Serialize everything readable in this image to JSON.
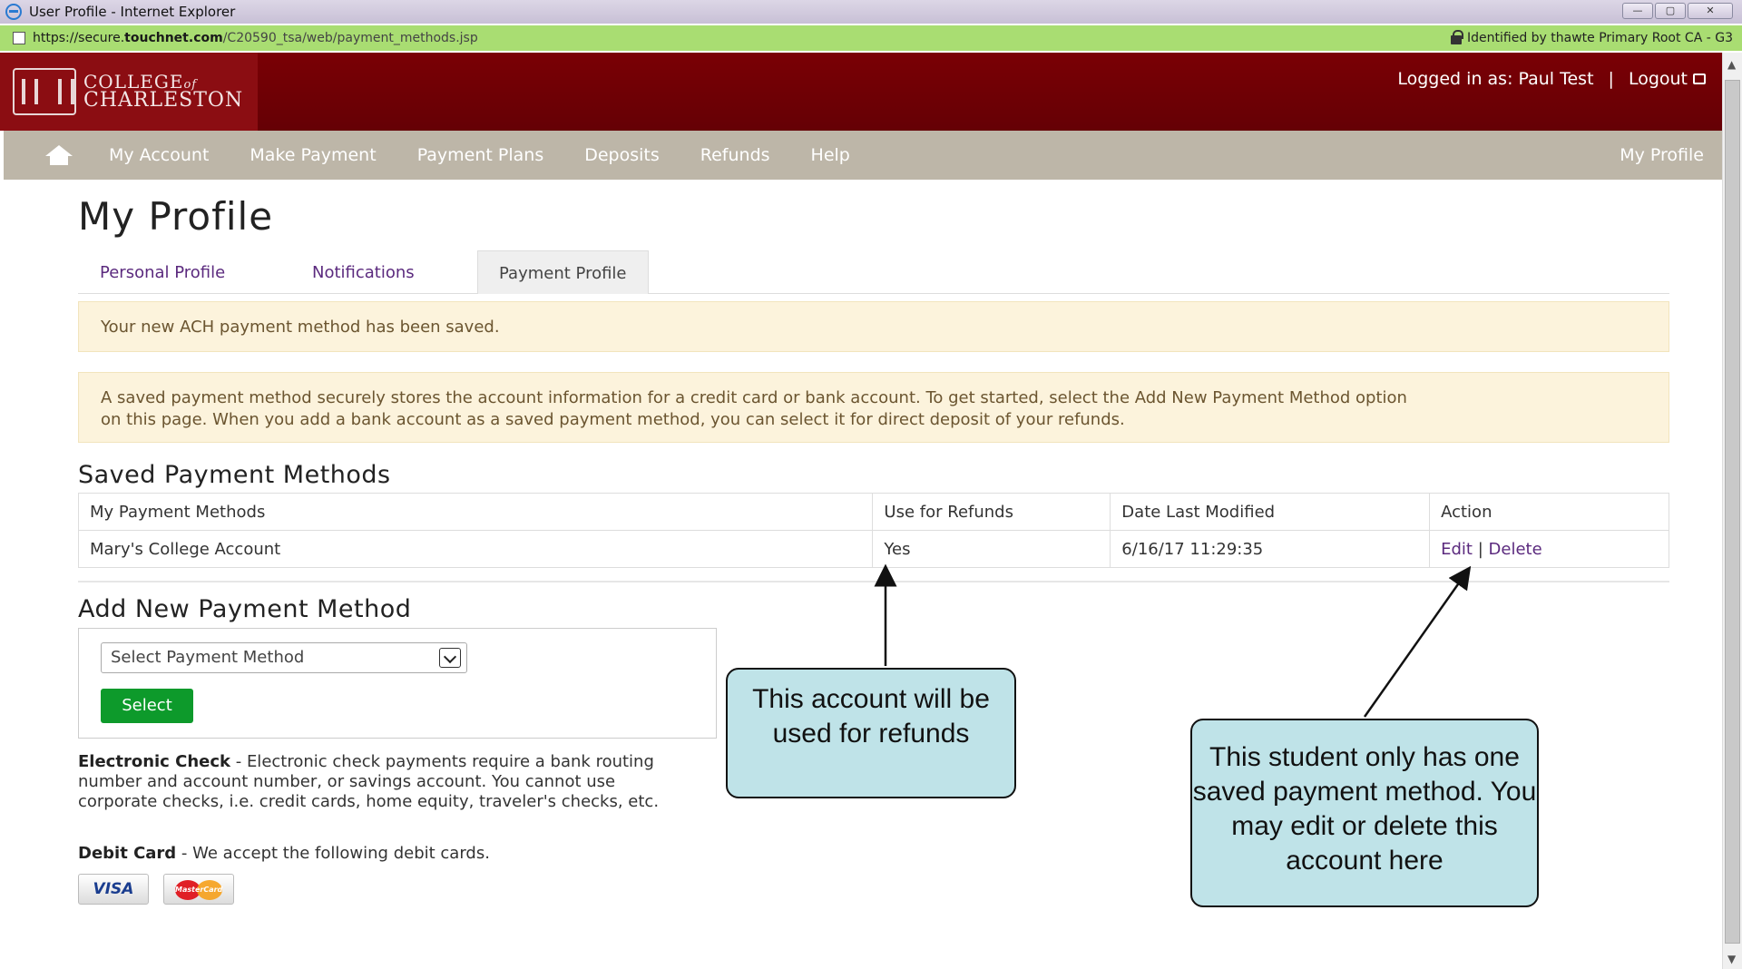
{
  "window": {
    "title": "User Profile - Internet Explorer",
    "controls": [
      "—",
      "▢",
      "✕"
    ]
  },
  "address_bar": {
    "url_scheme": "https://secure.",
    "url_domain": "touchnet.com",
    "url_path": "/C20590_tsa/web/payment_methods.jsp",
    "security_text": "Identified by thawte Primary Root CA - G3"
  },
  "header": {
    "logo_line1": "COLLEGE",
    "logo_line1_of": "of",
    "logo_line2": "CHARLESTON",
    "logged_in_text": "Logged in as: Paul Test",
    "separator": "|",
    "logout_label": "Logout"
  },
  "nav": {
    "items": [
      "My Account",
      "Make Payment",
      "Payment Plans",
      "Deposits",
      "Refunds",
      "Help"
    ],
    "right_item": "My Profile"
  },
  "page": {
    "title": "My Profile",
    "tabs": [
      "Personal Profile",
      "Notifications",
      "Payment Profile"
    ],
    "active_tab": "Payment Profile",
    "success_message": "Your new ACH payment method has been saved.",
    "info_message_line1": "A saved payment method securely stores the account information for a credit card or bank account. To get started, select the Add New Payment Method option",
    "info_message_line2": "on this page. When you add a bank account as a saved payment method, you can select it for direct deposit of your refunds."
  },
  "saved_methods": {
    "title": "Saved Payment Methods",
    "columns": [
      "My Payment Methods",
      "Use for Refunds",
      "Date Last Modified",
      "Action"
    ],
    "rows": [
      {
        "name": "Mary's College Account",
        "use_for_refunds": "Yes",
        "date_modified": "6/16/17 11:29:35",
        "edit_label": "Edit",
        "action_separator": "|",
        "delete_label": "Delete"
      }
    ]
  },
  "add_method": {
    "title": "Add New Payment Method",
    "select_value": "Select Payment Method",
    "select_button": "Select"
  },
  "payment_info": {
    "echeck_title": "Electronic Check",
    "echeck_text": " - Electronic check payments require a bank routing number and account number, or savings account. You cannot use corporate checks, i.e. credit cards, home equity, traveler's checks, etc.",
    "debit_title": "Debit Card",
    "debit_text": " - We accept the following debit cards.",
    "card_visa": "VISA",
    "card_mastercard": "MasterCard"
  },
  "callouts": {
    "refunds_note": "This account will be used for refunds",
    "edit_note": "This student only has one saved payment method.  You may edit or delete this account here"
  },
  "colors": {
    "header_bg": "#6b0005",
    "nav_bg": "#bdb6a8",
    "link": "#5b2a7e",
    "alert_bg": "#fcf3dc",
    "button_green": "#0d9a2b",
    "callout_bg": "#bfe3e8",
    "address_bar_bg": "#a9dd72"
  }
}
